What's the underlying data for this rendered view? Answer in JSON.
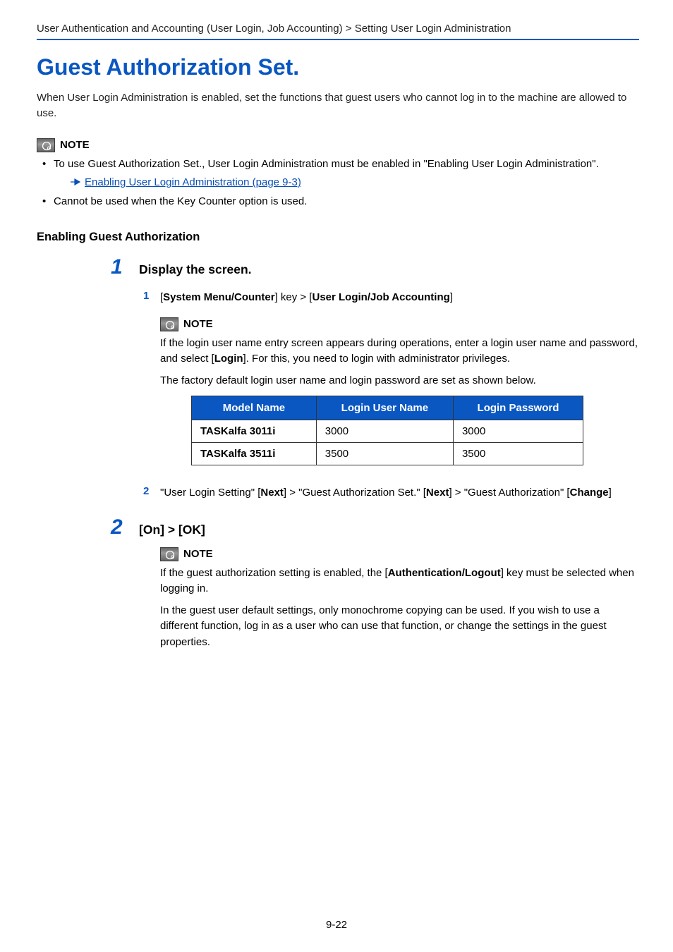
{
  "breadcrumb": "User Authentication and Accounting (User Login, Job Accounting) > Setting User Login Administration",
  "title": "Guest Authorization Set.",
  "intro": "When User Login Administration is enabled, set the functions that guest users who cannot log in to the machine are allowed to use.",
  "note_label": "NOTE",
  "top_notes": {
    "bullet1": "To use Guest Authorization Set., User Login Administration must be enabled in \"Enabling User Login Administration\".",
    "link": "Enabling User Login Administration (page 9-3)",
    "bullet2": "Cannot be used when the Key Counter option is used."
  },
  "section_heading": "Enabling Guest Authorization",
  "step1": {
    "num": "1",
    "title": "Display the screen.",
    "sub1": {
      "num": "1",
      "prefix": "[",
      "b1": "System Menu/Counter",
      "mid": "] key > [",
      "b2": "User Login/Job Accounting",
      "suffix": "]"
    },
    "note1": {
      "p1a": "If the login user name entry screen appears during operations, enter a login user name and password, and select [",
      "p1b": "Login",
      "p1c": "]. For this, you need to login with administrator privileges.",
      "p2": "The factory default login user name and login password are set as shown below."
    },
    "table": {
      "headers": {
        "c1": "Model Name",
        "c2": "Login User Name",
        "c3": "Login Password"
      },
      "rows": [
        {
          "model": "TASKalfa 3011i",
          "user": "3000",
          "pass": "3000"
        },
        {
          "model": "TASKalfa 3511i",
          "user": "3500",
          "pass": "3500"
        }
      ]
    },
    "sub2": {
      "num": "2",
      "t1": "\"User Login Setting\" [",
      "b1": "Next",
      "t2": "] > \"Guest Authorization Set.\" [",
      "b2": "Next",
      "t3": "] > \"Guest Authorization\" [",
      "b3": "Change",
      "t4": "]"
    }
  },
  "step2": {
    "num": "2",
    "title": "[On] > [OK]",
    "note": {
      "p1a": "If the guest authorization setting is enabled, the [",
      "p1b": "Authentication/Logout",
      "p1c": "] key must be selected when logging in.",
      "p2": "In the guest user default settings, only monochrome copying can be used. If you wish to use a different function, log in as a user who can use that function, or change the settings in the guest properties."
    }
  },
  "page_number": "9-22"
}
